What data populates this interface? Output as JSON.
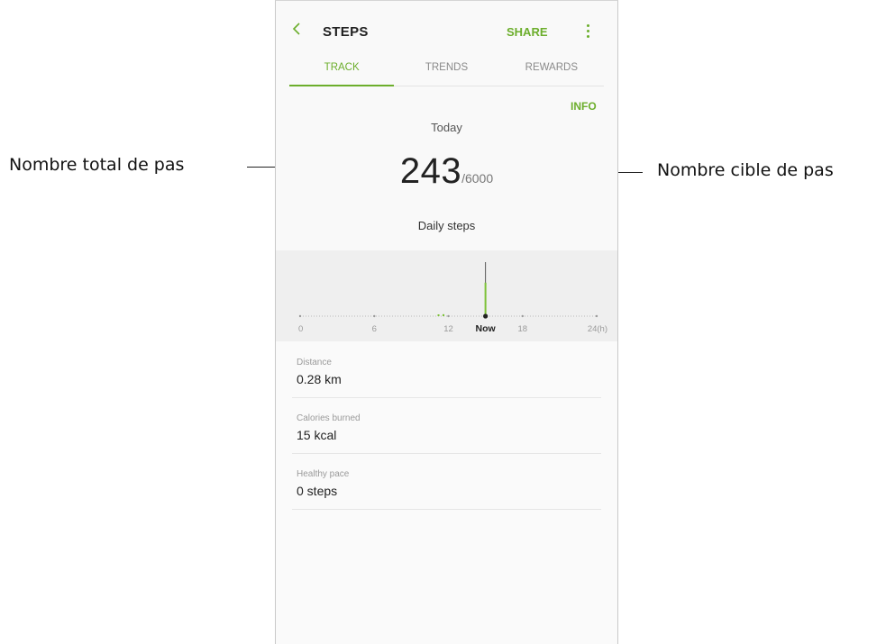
{
  "app": {
    "title": "STEPS",
    "share_label": "SHARE",
    "tabs": [
      {
        "label": "TRACK",
        "active": true
      },
      {
        "label": "TRENDS",
        "active": false
      },
      {
        "label": "REWARDS",
        "active": false
      }
    ],
    "info_label": "INFO",
    "day_label": "Today",
    "steps_total": "243",
    "steps_goal": "/6000",
    "daily_label": "Daily steps",
    "accent_color": "#6cae2c"
  },
  "chart_data": {
    "type": "bar",
    "x_ticks": [
      "0",
      "6",
      "12",
      "Now",
      "18",
      "24(h)"
    ],
    "now_hour": 15,
    "note": "",
    "bars": [
      {
        "hour": 11.2,
        "value": 8
      },
      {
        "hour": 11.6,
        "value": 14
      },
      {
        "hour": 15,
        "value": 243
      }
    ]
  },
  "stats": [
    {
      "label": "Distance",
      "value": "0.28 km"
    },
    {
      "label": "Calories burned",
      "value": "15 kcal"
    },
    {
      "label": "Healthy pace",
      "value": "0 steps"
    }
  ],
  "annotations": {
    "left": "Nombre total de pas",
    "right": "Nombre cible de pas"
  }
}
